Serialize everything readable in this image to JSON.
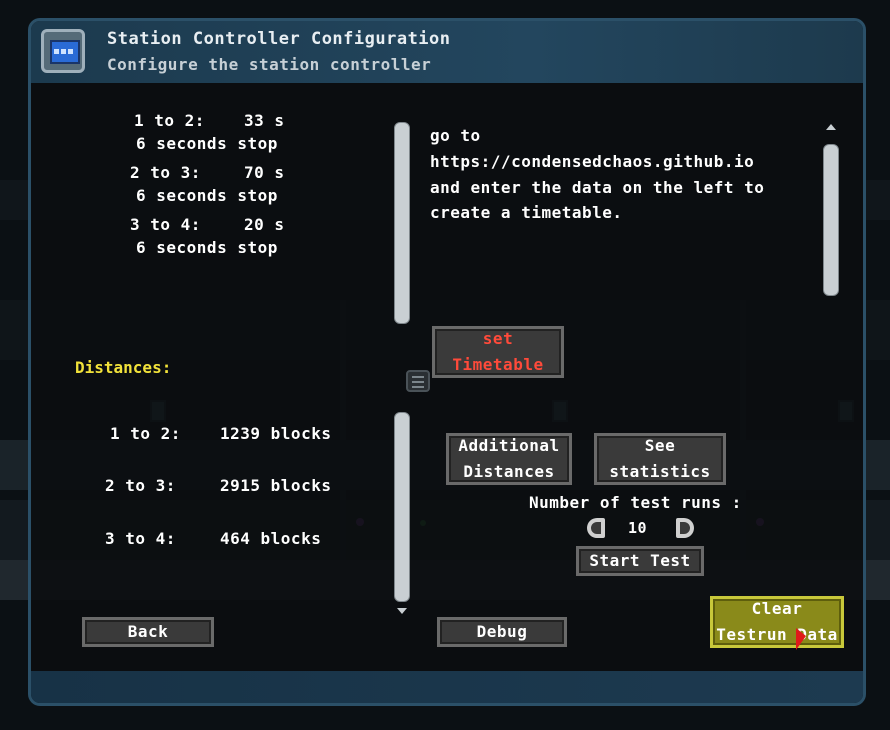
{
  "window": {
    "title": "Station Controller Configuration",
    "subtitle": "Configure the station controller",
    "icon": "computer-terminal-icon"
  },
  "timetable": {
    "segments": [
      {
        "route": "1 to 2:",
        "time": "33 s",
        "stop": "6 seconds stop"
      },
      {
        "route": "2 to 3:",
        "time": "70 s",
        "stop": "6 seconds stop"
      },
      {
        "route": "3 to 4:",
        "time": "20 s",
        "stop": "6 seconds stop"
      }
    ]
  },
  "info": {
    "lines": [
      "go to",
      "https://condensedchaos.github.io",
      "and enter the data on the left to",
      "create a timetable."
    ]
  },
  "set_timetable_button": {
    "line1": "set",
    "line2": "Timetable"
  },
  "distances": {
    "label": "Distances:",
    "rows": [
      {
        "route": "1 to 2:",
        "value": "1239 blocks"
      },
      {
        "route": "2 to 3:",
        "value": "2915 blocks"
      },
      {
        "route": "3 to 4:",
        "value": "464 blocks"
      }
    ]
  },
  "additional_distances_button": {
    "line1": "Additional",
    "line2": "Distances"
  },
  "see_statistics_button": {
    "line1": "See",
    "line2": "statistics"
  },
  "test_runs": {
    "label": "Number of test runs :",
    "value": "10"
  },
  "start_test_button": "Start Test",
  "back_button": "Back",
  "debug_button": "Debug",
  "clear_testrun_button": {
    "line1": "Clear",
    "line2": "Testrun Data"
  },
  "colors": {
    "header": "#23465e",
    "distances_label": "#f2e23a",
    "set_timetable_text": "#ff4a3a",
    "clear_button": "#8a8a1a"
  }
}
